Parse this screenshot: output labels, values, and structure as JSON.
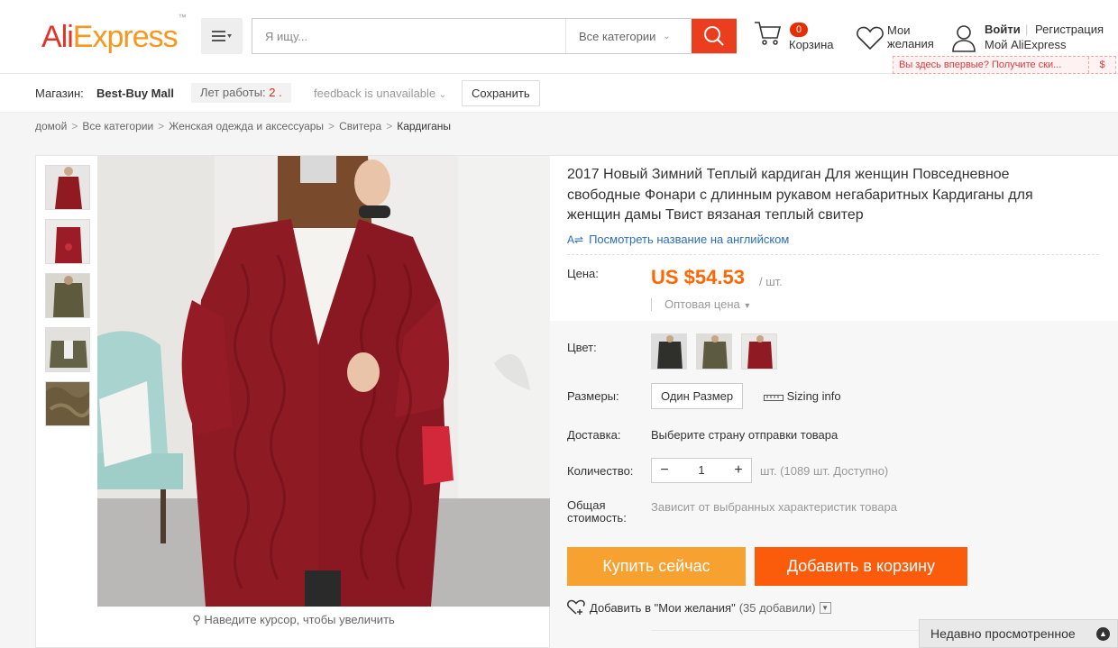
{
  "header": {
    "logo_ali": "Ali",
    "logo_express": "Express",
    "logo_tm": "™",
    "search_placeholder": "Я ищу...",
    "search_category": "Все категории",
    "cart_count": "0",
    "cart_label": "Корзина",
    "wishlist_label": "Мои желания",
    "login": "Войти",
    "register": "Регистрация",
    "my_account": "Мой AliExpress",
    "promo_text": "Вы здесь впервые? Получите ски...",
    "promo_icon": "$"
  },
  "store": {
    "shop_label": "Магазин:",
    "shop_name": "Best-Buy Mall",
    "years_label": "Лет работы:",
    "years_value": "2 .",
    "feedback": "feedback is unavailable",
    "save_button": "Сохранить"
  },
  "breadcrumb": [
    "домой",
    "Все категории",
    "Женская одежда и аксессуары",
    "Свитера",
    "Кардиганы"
  ],
  "gallery": {
    "zoom_hint": "Наведите курсор, чтобы увеличить"
  },
  "product": {
    "title": "2017 Новый Зимний Теплый кардиган Для женщин Повседневное свободные Фонари с длинным рукавом негабаритных Кардиганы для женщин дамы Твист вязаная теплый свитер",
    "translate_link": "Посмотреть название на английском",
    "price_label": "Цена:",
    "price": "US $54.53",
    "price_unit": "/ шт.",
    "wholesale": "Оптовая цена",
    "color_label": "Цвет:",
    "size_label": "Размеры:",
    "size_option": "Один Размер",
    "sizing_info": "Sizing info",
    "shipping_label": "Доставка:",
    "shipping_value": "Выберите страну отправки товара",
    "quantity_label": "Количество:",
    "quantity_value": "1",
    "quantity_available": "шт. (1089 шт. Доступно)",
    "total_label": "Общая стоимость:",
    "total_value": "Зависит от выбранных характеристик товара",
    "buy_now": "Купить сейчас",
    "add_to_cart": "Добавить в корзину",
    "add_to_wishlist": "Добавить в \"Мои желания\"",
    "wishlist_count": "(35 добавили)"
  },
  "recently_viewed": "Недавно просмотренное",
  "colors": {
    "brand_red": "#e43225",
    "brand_orange": "#f7971d",
    "price": "#ff6600",
    "buy_now": "#f7a131",
    "add_to_cart": "#fa5c0c",
    "search_button": "#ea3e1e",
    "link": "#2a6ebb"
  }
}
